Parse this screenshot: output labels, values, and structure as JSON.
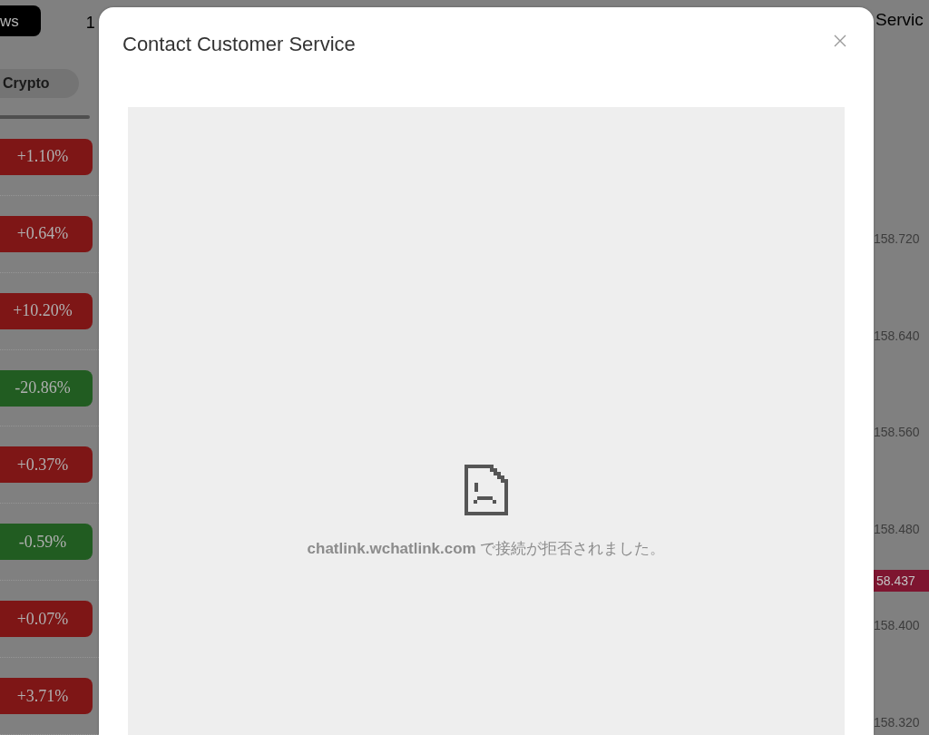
{
  "background_page": {
    "top_bar": {
      "item_1": "ws",
      "item_2": "1",
      "item_3": "Servic"
    },
    "category_tab": {
      "label": "Crypto",
      "selected": true
    },
    "change_badges": [
      {
        "text": "+1.10%",
        "color": "#7e1616"
      },
      {
        "text": "+0.64%",
        "color": "#7e1616"
      },
      {
        "text": "+10.20%",
        "color": "#7e1616"
      },
      {
        "text": "-20.86%",
        "color": "#215c21"
      },
      {
        "text": "+0.37%",
        "color": "#7e1616"
      },
      {
        "text": "-0.59%",
        "color": "#215c21"
      },
      {
        "text": "+0.07%",
        "color": "#7e1616"
      },
      {
        "text": "+3.71%",
        "color": "#7e1616"
      }
    ],
    "price_axis": {
      "labels": [
        "158.720",
        "158.640",
        "158.560",
        "158.480",
        "158.400",
        "158.320"
      ],
      "current_price": "58.437"
    }
  },
  "dialog": {
    "title": "Contact Customer Service",
    "error_message": "**chatlink.wchatlink.com** で接続が拒否されました。"
  }
}
